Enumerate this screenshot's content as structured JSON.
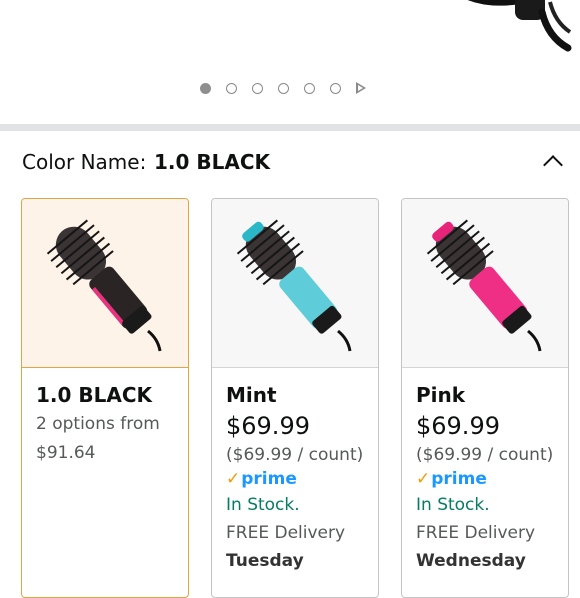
{
  "carousel": {
    "dot_count": 6,
    "active_index": 0
  },
  "variation": {
    "label": "Color Name:",
    "selected": "1.0 BLACK"
  },
  "options": [
    {
      "name": "1.0 BLACK",
      "options_text": "2 options from",
      "from_price": "$91.64",
      "accent": "#1c1c1c",
      "handle": "#2a2524",
      "stripe": "#e8337f"
    },
    {
      "name": "Mint",
      "price": "$69.99",
      "unit_price": "($69.99 / count)",
      "prime": "prime",
      "stock": "In Stock.",
      "delivery": "FREE Delivery",
      "day": "Tuesday",
      "accent": "#2ab7c7",
      "handle": "#5fcdd9"
    },
    {
      "name": "Pink",
      "price": "$69.99",
      "unit_price": "($69.99 / count)",
      "prime": "prime",
      "stock": "In Stock.",
      "delivery": "FREE Delivery",
      "day": "Wednesday",
      "accent": "#e8237a",
      "handle": "#ef2f86"
    }
  ]
}
